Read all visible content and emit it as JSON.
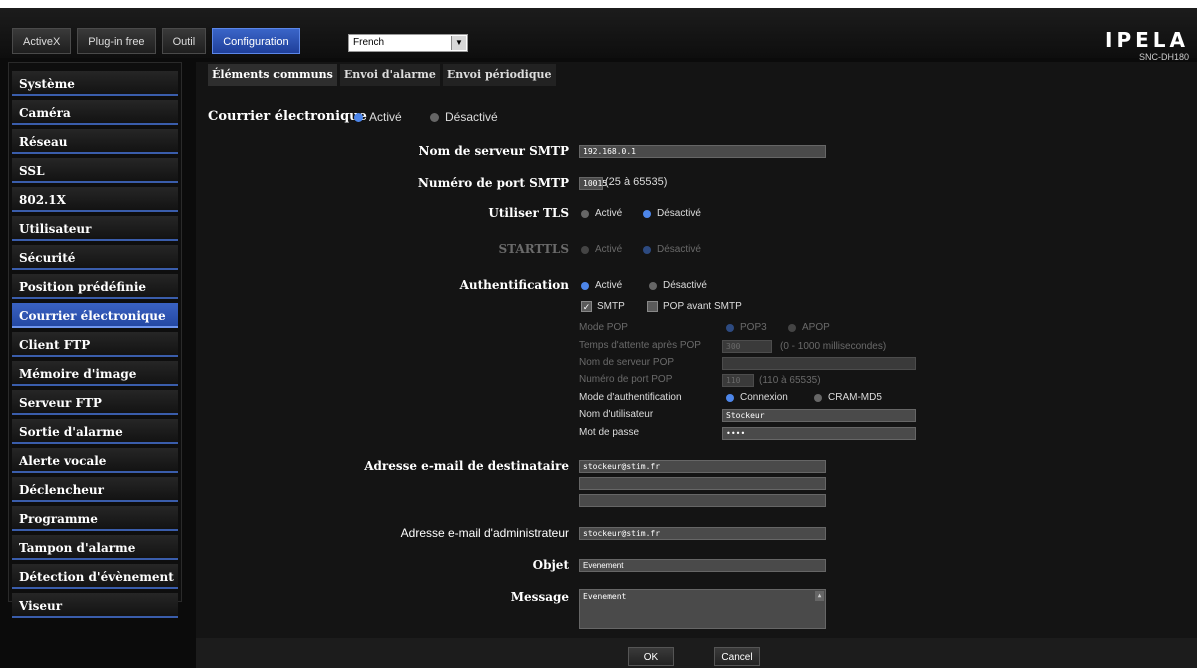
{
  "topnav": {
    "items": [
      "ActiveX",
      "Plug-in free",
      "Outil",
      "Configuration"
    ],
    "active": "Configuration"
  },
  "language": {
    "selected": "French"
  },
  "logo": {
    "brand": "IPELA",
    "model": "SNC-DH180"
  },
  "sidebar": {
    "items": [
      "Système",
      "Caméra",
      "Réseau",
      "SSL",
      "802.1X",
      "Utilisateur",
      "Sécurité",
      "Position prédéfinie",
      "Courrier électronique",
      "Client FTP",
      "Mémoire d'image",
      "Serveur FTP",
      "Sortie d'alarme",
      "Alerte vocale",
      "Déclencheur",
      "Programme",
      "Tampon d'alarme",
      "Détection d'évènement",
      "Viseur"
    ],
    "active": "Courrier électronique"
  },
  "tabs": [
    "Éléments communs",
    "Envoi d'alarme",
    "Envoi périodique"
  ],
  "form": {
    "email_label": "Courrier électronique",
    "on": "Activé",
    "off": "Désactivé",
    "smtp_server_label": "Nom de serveur SMTP",
    "smtp_server": "192.168.0.1",
    "smtp_port_label": "Numéro de port SMTP",
    "smtp_port": "10015",
    "smtp_port_range": "(25 à 65535)",
    "tls_label": "Utiliser TLS",
    "starttls_label": "STARTTLS",
    "auth_label": "Authentification",
    "smtp_check": "SMTP",
    "pop_check": "POP avant SMTP",
    "pop_mode_label": "Mode POP",
    "pop3": "POP3",
    "apop": "APOP",
    "pop_wait_label": "Temps d'attente après POP",
    "pop_wait": "300",
    "pop_wait_range": "(0 - 1000 millisecondes)",
    "pop_server_label": "Nom de serveur POP",
    "pop_port_label": "Numéro de port POP",
    "pop_port": "110",
    "pop_port_range": "(110 à 65535)",
    "auth_mode_label": "Mode d'authentification",
    "connexion": "Connexion",
    "cram": "CRAM-MD5",
    "username_label": "Nom d'utilisateur",
    "username": "Stockeur",
    "password_label": "Mot de passe",
    "password": "••••",
    "recipient_label": "Adresse e-mail de destinataire",
    "recipient": "stockeur@stim.fr",
    "admin_label": "Adresse e-mail d'administrateur",
    "admin": "stockeur@stim.fr",
    "subject_label": "Objet",
    "subject": "Evenement",
    "message_label": "Message",
    "message": "Evenement"
  },
  "footer": {
    "ok": "OK",
    "cancel": "Cancel"
  },
  "colors": {
    "accent": "#3a62c2",
    "radio_on": "#4d86ea"
  }
}
